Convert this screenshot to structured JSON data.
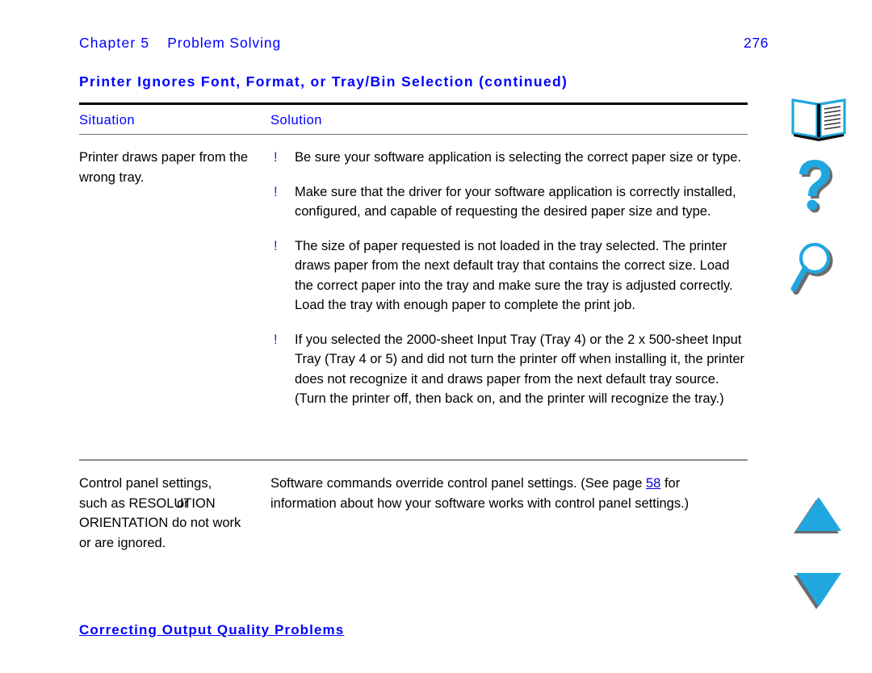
{
  "header": {
    "chapter_label": "Chapter 5",
    "chapter_title": "Problem Solving",
    "page_number": "276"
  },
  "section": {
    "title": "Printer Ignores Font, Format, or Tray/Bin Selection (continued)"
  },
  "table": {
    "columns": {
      "situation": "Situation",
      "solution": "Solution"
    },
    "rows": [
      {
        "situation": "Printer draws paper from the wrong tray.",
        "bullet_marker": "!",
        "solution_bullets": [
          "Be sure your software application is selecting the correct paper size or type.",
          "Make sure that the driver for your software application is correctly installed, configured, and capable of requesting the desired paper size and type.",
          "The size of paper requested is not loaded in the tray selected. The printer draws paper from the next default tray that contains the correct size. Load the correct paper into the tray and make sure the tray is adjusted correctly. Load the tray with enough paper to complete the print job.",
          "If you selected the 2000-sheet Input Tray (Tray 4) or the 2 x 500-sheet Input Tray (Tray 4 or 5) and did not turn the printer off when installing it, the printer does not recognize it and draws paper from the next default tray source. (Turn the printer off, then back on, and the printer will recognize the tray.)"
        ]
      },
      {
        "situation_line1": "Control panel settings,",
        "situation_line2_a": "such as RESOLUTION",
        "situation_line2_b": "or",
        "situation_line3_a": "ORIENTATION",
        "situation_line3_b": "do not work",
        "situation_line4": "or are ignored.",
        "solution_before_link": "Software commands override control panel settings. (See page ",
        "solution_link": "58",
        "solution_after_link": " for information about how your software works with control panel settings.)"
      }
    ]
  },
  "footer": {
    "link_text": "Correcting Output Quality Problems"
  },
  "rail": {
    "icons": [
      {
        "name": "book-icon",
        "label": "Contents"
      },
      {
        "name": "question-mark-icon",
        "label": "Help"
      },
      {
        "name": "magnifying-glass-icon",
        "label": "Search"
      },
      {
        "name": "triangle-up-icon",
        "label": "Previous page"
      },
      {
        "name": "triangle-down-icon",
        "label": "Next page"
      }
    ]
  },
  "colors": {
    "link_blue": "#0000ff",
    "icon_cyan": "#21a7e0",
    "icon_shadow": "#6b6b6b",
    "rule_black": "#000000",
    "rule_gray": "#8a8a8a"
  }
}
